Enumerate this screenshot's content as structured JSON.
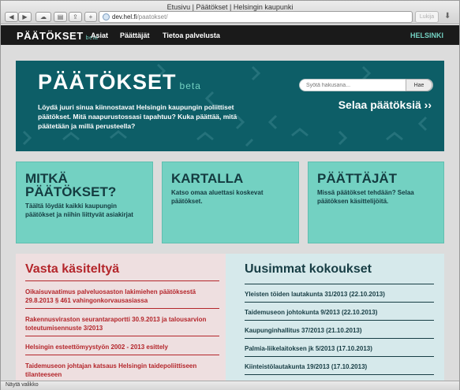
{
  "window": {
    "title": "Etusivu | Päätökset | Helsingin kaupunki"
  },
  "browser": {
    "url_host": "dev.hel.fi",
    "url_path": "/paatokset/",
    "reader_label": "Lukija",
    "status_text": "Näytä valikko"
  },
  "nav": {
    "logo": "PÄÄTÖKSET",
    "logo_beta": "beta",
    "links": [
      "Asiat",
      "Päättäjät",
      "Tietoa palvelusta"
    ],
    "city": "HELSINKI"
  },
  "hero": {
    "logo": "PÄÄTÖKSET",
    "beta": "beta",
    "text": "Löydä juuri sinua kiinnostavat Helsingin kaupungin poliittiset päätökset. Mitä naapurustossasi tapahtuu? Kuka päättää, mitä päätetään ja millä perusteella?",
    "search_placeholder": "Syötä hakusana...",
    "search_button": "Hae",
    "browse_link": "Selaa päätöksiä ››"
  },
  "cards": [
    {
      "title": "MITKÄ PÄÄTÖKSET?",
      "text": "Täältä löydät kaikki kaupungin päätökset ja niihin liittyvät asiakirjat"
    },
    {
      "title": "KARTALLA",
      "text": "Katso omaa aluettasi koskevat päätökset."
    },
    {
      "title": "PÄÄTTÄJÄT",
      "text": "Missä päätökset tehdään? Selaa päätöksen käsittelijöitä."
    }
  ],
  "recent": {
    "title": "Vasta käsiteltyä",
    "items": [
      "Oikaisuvaatimus palveluosaston lakimiehen päätöksestä 29.8.2013 § 461 vahingonkorvausasiassa",
      "Rakennusviraston seurantaraportti 30.9.2013 ja talousarvion toteutumisennuste 3/2013",
      "Helsingin esteettömyystyön 2002 - 2013 esittely",
      "Taidemuseon johtajan katsaus Helsingin taidepoliittiseen tilanteeseen"
    ]
  },
  "meetings": {
    "title": "Uusimmat kokoukset",
    "items": [
      "Yleisten töiden lautakunta 31/2013 (22.10.2013)",
      "Taidemuseon johtokunta 9/2013 (22.10.2013)",
      "Kaupunginhallitus 37/2013 (21.10.2013)",
      "Palmia-liikelaitoksen jk 5/2013 (17.10.2013)",
      "Kiinteistölautakunta 19/2013 (17.10.2013)"
    ]
  },
  "colors": {
    "accent_teal": "#73d1c2",
    "hero_bg": "#0d5e67",
    "recent_red": "#b4262b",
    "dark_teal": "#173d44"
  }
}
